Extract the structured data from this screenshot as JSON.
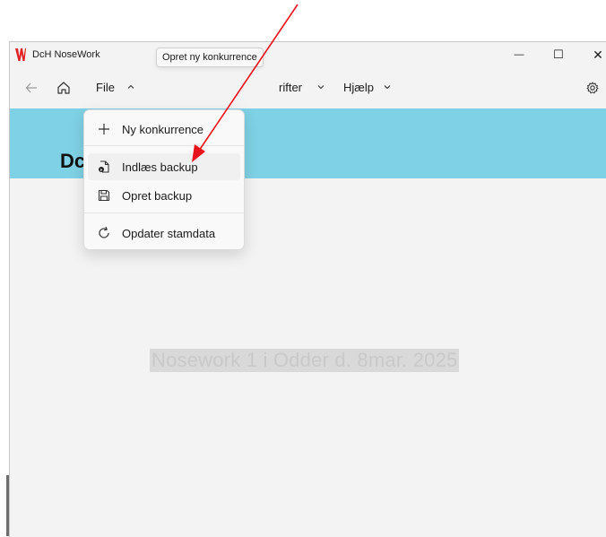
{
  "app": {
    "title": "DcH NoseWork"
  },
  "window_controls": {
    "minimize": "—",
    "maximize": "☐",
    "close": "✕"
  },
  "nav": {
    "back_icon": "arrow-left-icon",
    "home_icon": "home-icon",
    "menus": [
      {
        "label": "File",
        "state": "open"
      },
      {
        "label": "rifter",
        "state": "closed"
      },
      {
        "label": "Hjælp",
        "state": "closed"
      }
    ],
    "settings_icon": "gear-icon"
  },
  "tooltip": {
    "text": "Opret ny konkurrence"
  },
  "banner": {
    "title": "Dc",
    "color": "#7fd1e5"
  },
  "file_menu": {
    "items": [
      {
        "label": "Ny konkurrence",
        "icon": "plus-icon"
      },
      {
        "label": "Indlæs backup",
        "icon": "open-file-icon"
      },
      {
        "label": "Opret backup",
        "icon": "save-icon"
      },
      {
        "label": "Opdater stamdata",
        "icon": "refresh-icon"
      }
    ]
  },
  "watermark": {
    "text": "Nosework 1 i Odder d. 8mar. 2025"
  },
  "annotation": {
    "color": "#e8141b"
  }
}
